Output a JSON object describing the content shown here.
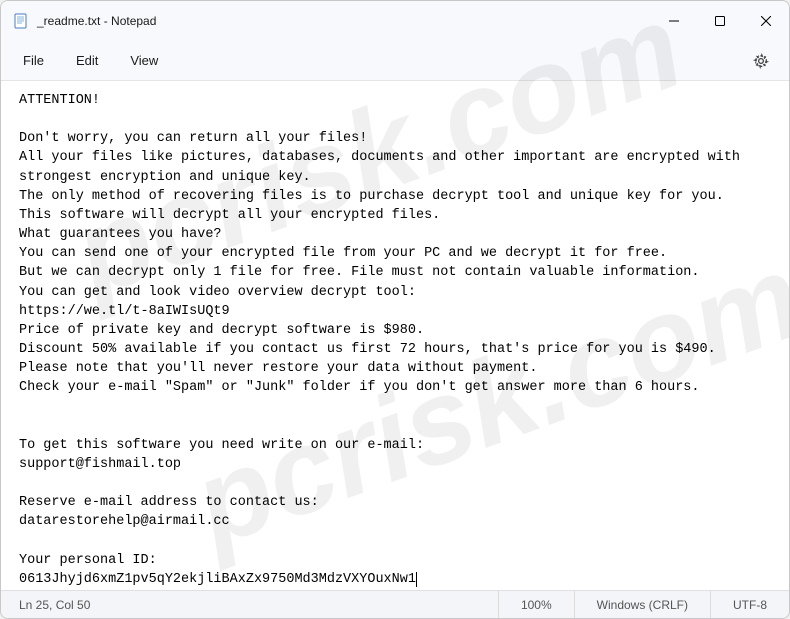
{
  "window": {
    "title": "_readme.txt - Notepad"
  },
  "menu": {
    "file": "File",
    "edit": "Edit",
    "view": "View"
  },
  "content": {
    "body": "ATTENTION!\n\nDon't worry, you can return all your files!\nAll your files like pictures, databases, documents and other important are encrypted with strongest encryption and unique key.\nThe only method of recovering files is to purchase decrypt tool and unique key for you.\nThis software will decrypt all your encrypted files.\nWhat guarantees you have?\nYou can send one of your encrypted file from your PC and we decrypt it for free.\nBut we can decrypt only 1 file for free. File must not contain valuable information.\nYou can get and look video overview decrypt tool:\nhttps://we.tl/t-8aIWIsUQt9\nPrice of private key and decrypt software is $980.\nDiscount 50% available if you contact us first 72 hours, that's price for you is $490.\nPlease note that you'll never restore your data without payment.\nCheck your e-mail \"Spam\" or \"Junk\" folder if you don't get answer more than 6 hours.\n\n\nTo get this software you need write on our e-mail:\nsupport@fishmail.top\n\nReserve e-mail address to contact us:\ndatarestorehelp@airmail.cc\n\nYour personal ID:\n0613Jhyjd6xmZ1pv5qY2ekjliBAxZx9750Md3MdzVXYOuxNw1"
  },
  "status": {
    "position": "Ln 25, Col 50",
    "zoom": "100%",
    "line_ending": "Windows (CRLF)",
    "encoding": "UTF-8"
  },
  "watermark": {
    "text": "pcrisk.com"
  }
}
